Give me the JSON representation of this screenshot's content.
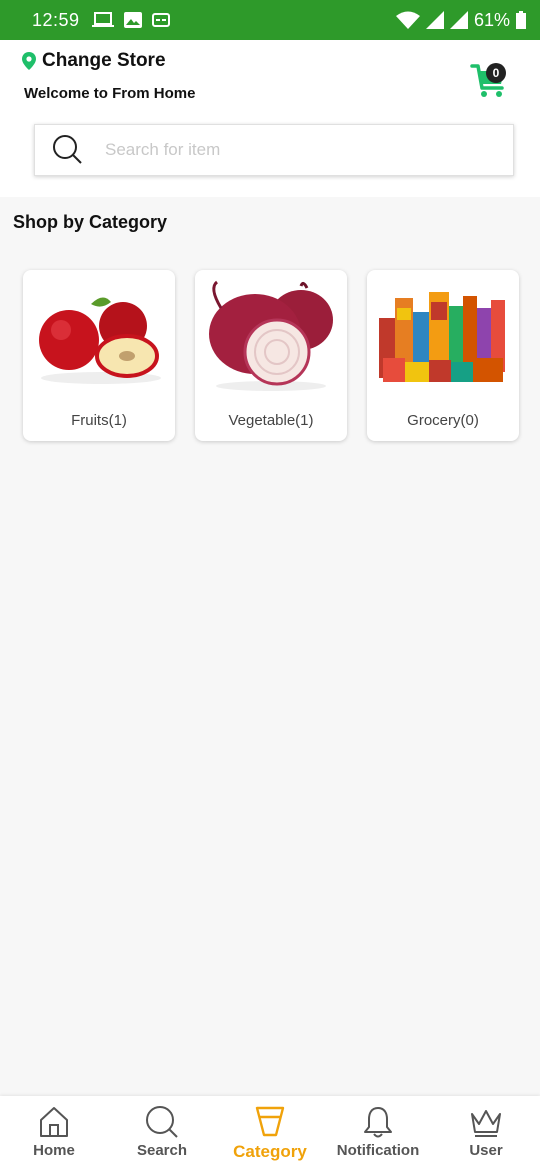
{
  "status_bar": {
    "time": "12:59",
    "battery": "61%"
  },
  "header": {
    "store_label": "Change Store",
    "welcome_text": "Welcome to From Home",
    "cart_count": "0"
  },
  "search": {
    "placeholder": "Search for item"
  },
  "section": {
    "title": "Shop by Category"
  },
  "categories": [
    {
      "label": "Fruits(1)",
      "icon": "apples-image"
    },
    {
      "label": "Vegetable(1)",
      "icon": "onion-image"
    },
    {
      "label": "Grocery(0)",
      "icon": "grocery-products-image"
    }
  ],
  "bottom_nav": {
    "items": [
      {
        "label": "Home",
        "icon": "home-icon"
      },
      {
        "label": "Search",
        "icon": "search-icon"
      },
      {
        "label": "Category",
        "icon": "category-icon",
        "active": true
      },
      {
        "label": "Notification",
        "icon": "bell-icon"
      },
      {
        "label": "User",
        "icon": "crown-icon"
      }
    ]
  },
  "colors": {
    "status_bar": "#2e9a2a",
    "accent_green": "#1fbf6a",
    "active_nav": "#f0a20a"
  }
}
